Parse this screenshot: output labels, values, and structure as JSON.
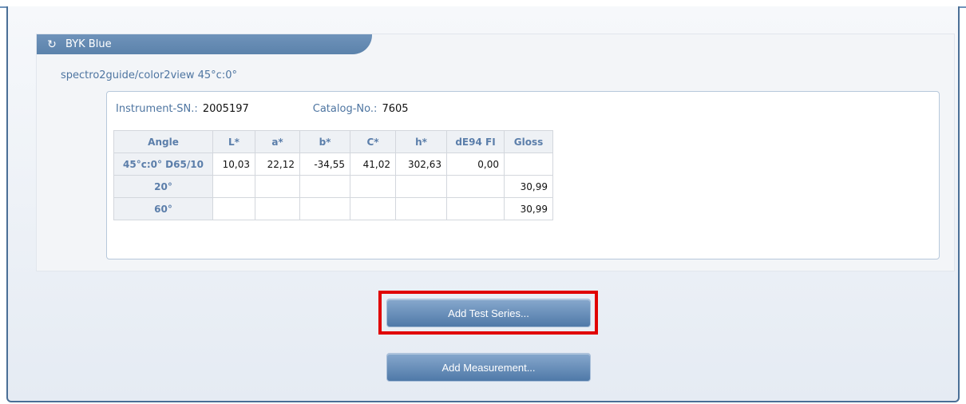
{
  "panel": {
    "title": "BYK Blue",
    "subtitle": "spectro2guide/color2view 45°c:0°",
    "icon": "refresh-icon",
    "colors": {
      "tab": "#5b82ab",
      "label": "#4e75a1",
      "highlight": "#e00000"
    }
  },
  "meta": {
    "instrument_label": "Instrument-SN.:",
    "instrument_value": "2005197",
    "catalog_label": "Catalog-No.:",
    "catalog_value": "7605"
  },
  "table": {
    "headers": [
      "Angle",
      "L*",
      "a*",
      "b*",
      "C*",
      "h*",
      "dE94 FI",
      "Gloss"
    ],
    "rows": [
      [
        "45°c:0° D65/10",
        "10,03",
        "22,12",
        "-34,55",
        "41,02",
        "302,63",
        "0,00",
        ""
      ],
      [
        "20°",
        "",
        "",
        "",
        "",
        "",
        "",
        "30,99"
      ],
      [
        "60°",
        "",
        "",
        "",
        "",
        "",
        "",
        "30,99"
      ]
    ]
  },
  "buttons": {
    "add_test_series": "Add Test Series...",
    "add_measurement": "Add Measurement..."
  }
}
